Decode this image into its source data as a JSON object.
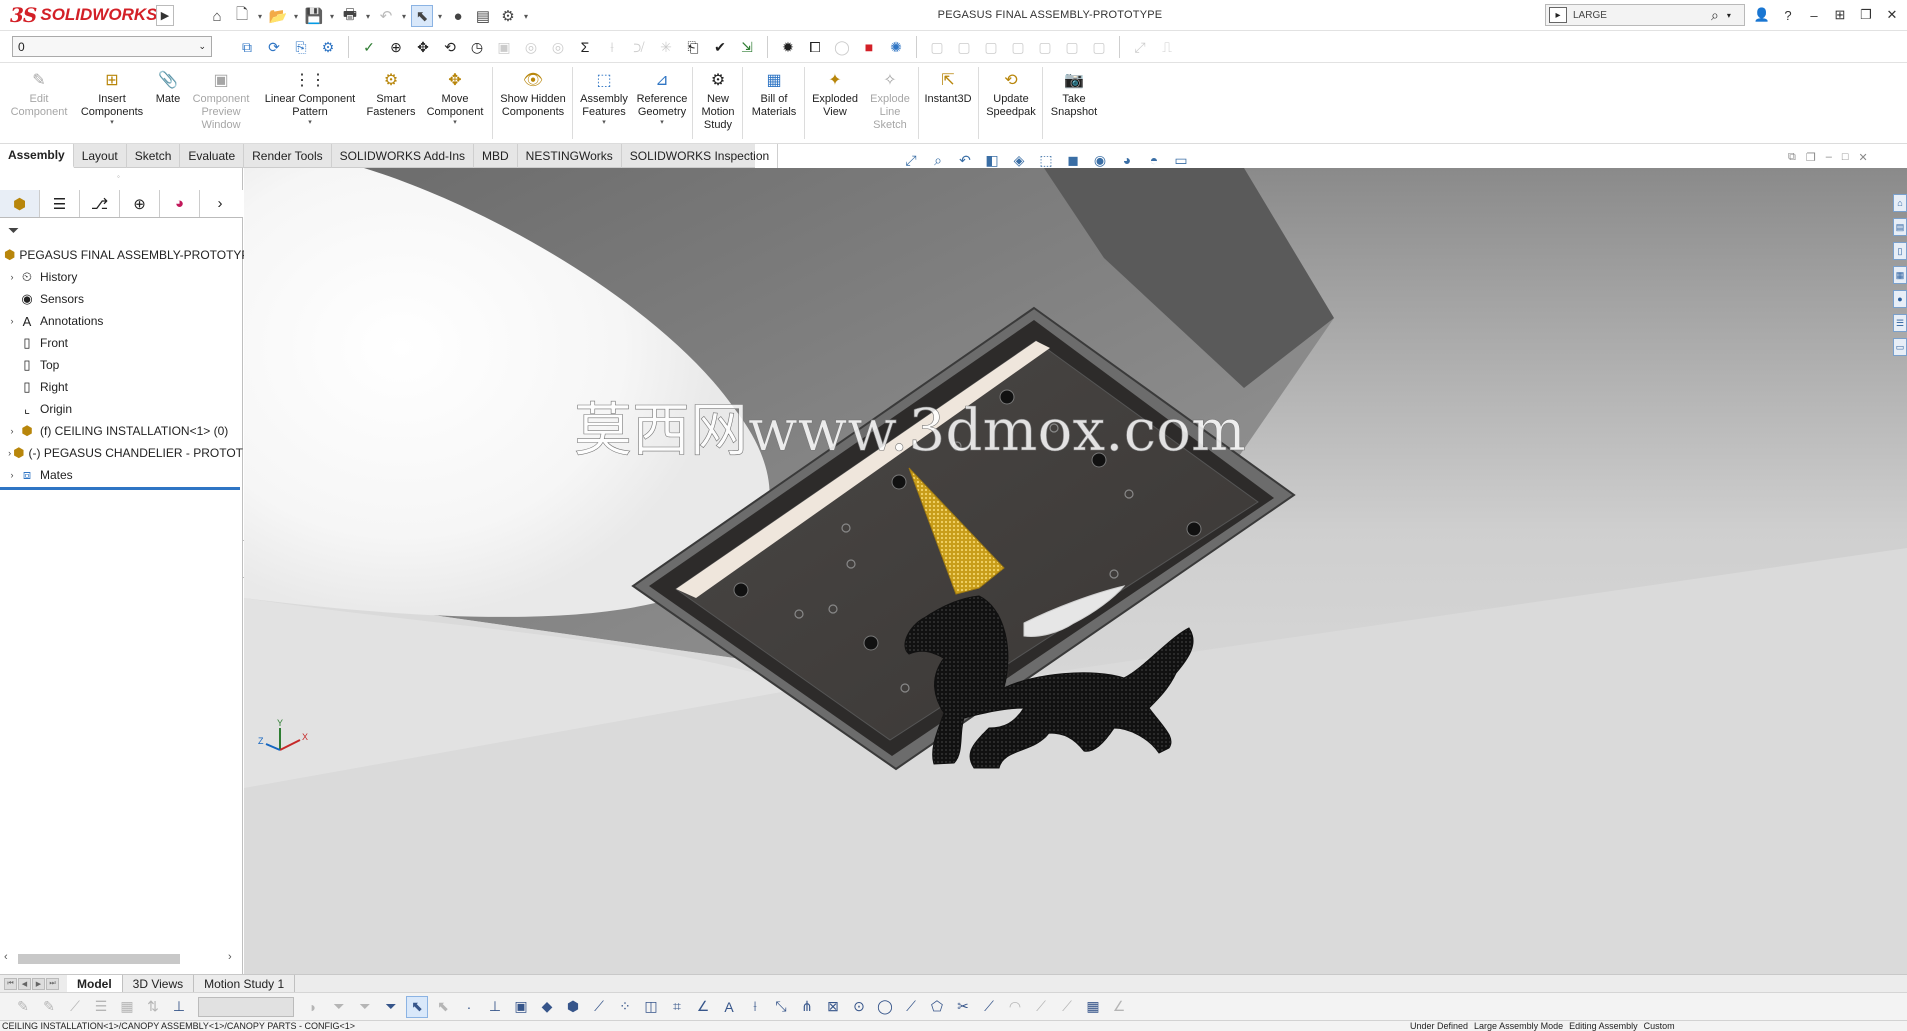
{
  "app": {
    "name": "SOLIDWORKS",
    "logo_mark": "3S",
    "document_title": "PEGASUS FINAL ASSEMBLY-PROTOTYPE"
  },
  "search": {
    "value": "LARGE",
    "placeholder": "Search"
  },
  "config_select": {
    "value": "0"
  },
  "ribbon": {
    "edit_component": "Edit Component",
    "insert_components": "Insert Components",
    "mate": "Mate",
    "component_preview": "Component Preview Window",
    "linear_pattern": "Linear Component Pattern",
    "smart_fasteners": "Smart Fasteners",
    "move_component": "Move Component",
    "show_hidden": "Show Hidden Components",
    "assembly_features": "Assembly Features",
    "reference_geometry": "Reference Geometry",
    "new_motion_study": "New Motion Study",
    "bill_of_materials": "Bill of Materials",
    "exploded_view": "Exploded View",
    "explode_line_sketch": "Explode Line Sketch",
    "instant3d": "Instant3D",
    "update_speedpak": "Update Speedpak",
    "take_snapshot": "Take Snapshot"
  },
  "tabs": [
    "Assembly",
    "Layout",
    "Sketch",
    "Evaluate",
    "Render Tools",
    "SOLIDWORKS Add-Ins",
    "MBD",
    "NESTINGWorks",
    "SOLIDWORKS Inspection"
  ],
  "tree": {
    "root": "PEGASUS FINAL ASSEMBLY-PROTOTYPE",
    "items": [
      "History",
      "Sensors",
      "Annotations",
      "Front",
      "Top",
      "Right",
      "Origin",
      "(f) CEILING INSTALLATION<1> (0)",
      "(-) PEGASUS CHANDELIER - PROTOT",
      "Mates"
    ]
  },
  "watermark": "莫西网www.3dmox.com",
  "triad": {
    "x": "X",
    "y": "Y",
    "z": "Z"
  },
  "bottom_tabs": [
    "Model",
    "3D Views",
    "Motion Study 1"
  ],
  "status": {
    "path": "CEILING INSTALLATION<1>/CANOPY ASSEMBLY<1>/CANOPY PARTS - CONFIG<1>",
    "state": "Under Defined",
    "mode": "Large Assembly Mode",
    "editing": "Editing Assembly",
    "custom": "Custom"
  },
  "colors": {
    "accent": "#2f75c4",
    "brand_red": "#d32027",
    "gold": "#d8b12b"
  }
}
